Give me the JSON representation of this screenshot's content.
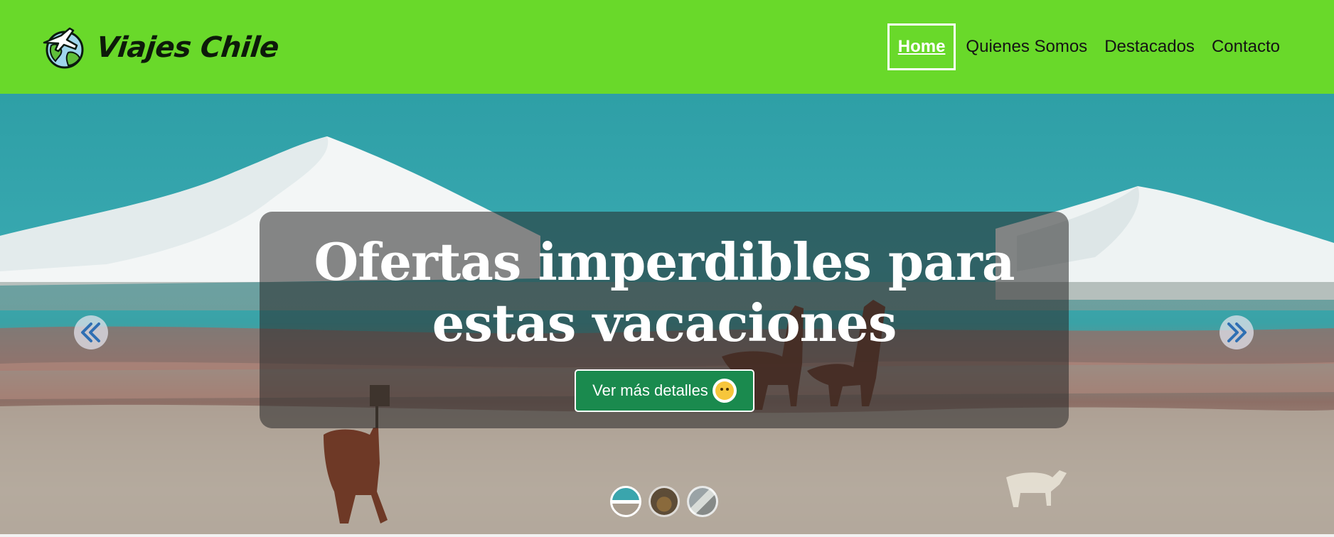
{
  "brand": {
    "name": "Viajes Chile",
    "logo_icon": "globe-airplane-icon"
  },
  "nav": {
    "items": [
      {
        "label": "Home",
        "active": true
      },
      {
        "label": "Quienes Somos",
        "active": false
      },
      {
        "label": "Destacados",
        "active": false
      },
      {
        "label": "Contacto",
        "active": false
      }
    ]
  },
  "hero": {
    "title": "Ofertas imperdibles para estas vacaciones",
    "cta_label": "Ver más detalles",
    "cta_icon": "smiling-face-emoji-icon",
    "prev_icon": "double-chevron-left-icon",
    "next_icon": "double-chevron-right-icon",
    "slides_count": 3,
    "active_slide": 1
  },
  "colors": {
    "navbar": "#69d92a",
    "cta_button": "#1a8a4e",
    "arrow_glyph": "#2f6fb3"
  }
}
